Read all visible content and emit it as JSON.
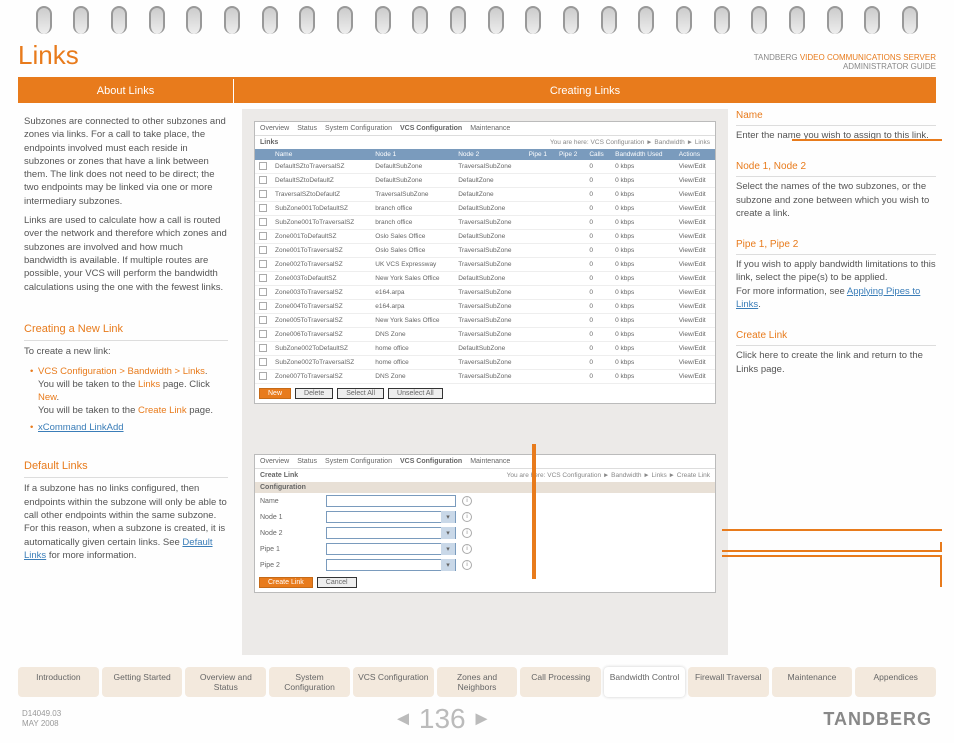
{
  "header": {
    "title": "Links",
    "brand_line": "TANDBERG",
    "brand_prod": "VIDEO COMMUNICATIONS SERVER",
    "brand_sub": "ADMINISTRATOR GUIDE"
  },
  "tabs": {
    "left": "About Links",
    "right": "Creating Links"
  },
  "about": {
    "p1": "Subzones are connected to other subzones and zones via links. For a call to take place, the endpoints involved must each reside in subzones or zones that have a link between them. The link does not need to be direct; the two endpoints may be linked via one or more intermediary subzones.",
    "p2": "Links are used to calculate how a call is routed over the network and therefore which zones and subzones are involved and how much bandwidth is available. If multiple routes are possible, your VCS will perform the bandwidth calculations using the one with the fewest links."
  },
  "create": {
    "title": "Creating a New Link",
    "intro": "To create a new link:",
    "b1a": "VCS Configuration > Bandwidth > Links",
    "b1b": ".",
    "b1c": "You will be taken to the ",
    "b1d": "Links",
    "b1e": " page. Click ",
    "b1f": "New",
    "b1g": ".",
    "b2a": "You will be taken to the ",
    "b2b": "Create Link",
    "b2c": " page.",
    "b3": "xCommand LinkAdd"
  },
  "default": {
    "title": "Default Links",
    "p": "If a subzone has no links configured, then endpoints within the subzone will only be able to call other endpoints within the same subzone. For this reason, when a subzone is created, it is automatically given certain links. See ",
    "link": "Default Links",
    "p2": " for more information."
  },
  "shot_nav": {
    "i1": "Overview",
    "i2": "Status",
    "i3": "System Configuration",
    "i4": "VCS Configuration",
    "i5": "Maintenance"
  },
  "shot1": {
    "title": "Links",
    "bc": "You are here: VCS Configuration ► Bandwidth ► Links",
    "cols": [
      "",
      "Name",
      "Node 1",
      "Node 2",
      "Pipe 1",
      "Pipe 2",
      "Calls",
      "Bandwidth Used",
      "Actions"
    ],
    "rows": [
      [
        "DefaultSZtoTraversalSZ",
        "DefaultSubZone",
        "TraversalSubZone",
        "",
        "",
        "0",
        "0 kbps",
        "View/Edit"
      ],
      [
        "DefaultSZtoDefaultZ",
        "DefaultSubZone",
        "DefaultZone",
        "",
        "",
        "0",
        "0 kbps",
        "View/Edit"
      ],
      [
        "TraversalSZtoDefaultZ",
        "TraversalSubZone",
        "DefaultZone",
        "",
        "",
        "0",
        "0 kbps",
        "View/Edit"
      ],
      [
        "SubZone001ToDefaultSZ",
        "branch office",
        "DefaultSubZone",
        "",
        "",
        "0",
        "0 kbps",
        "View/Edit"
      ],
      [
        "SubZone001ToTraversalSZ",
        "branch office",
        "TraversalSubZone",
        "",
        "",
        "0",
        "0 kbps",
        "View/Edit"
      ],
      [
        "Zone001ToDefaultSZ",
        "Oslo Sales Office",
        "DefaultSubZone",
        "",
        "",
        "0",
        "0 kbps",
        "View/Edit"
      ],
      [
        "Zone001ToTraversalSZ",
        "Oslo Sales Office",
        "TraversalSubZone",
        "",
        "",
        "0",
        "0 kbps",
        "View/Edit"
      ],
      [
        "Zone002ToTraversalSZ",
        "UK VCS Expressway",
        "TraversalSubZone",
        "",
        "",
        "0",
        "0 kbps",
        "View/Edit"
      ],
      [
        "Zone003ToDefaultSZ",
        "New York Sales Office",
        "DefaultSubZone",
        "",
        "",
        "0",
        "0 kbps",
        "View/Edit"
      ],
      [
        "Zone003ToTraversalSZ",
        "e164.arpa",
        "TraversalSubZone",
        "",
        "",
        "0",
        "0 kbps",
        "View/Edit"
      ],
      [
        "Zone004ToTraversalSZ",
        "e164.arpa",
        "TraversalSubZone",
        "",
        "",
        "0",
        "0 kbps",
        "View/Edit"
      ],
      [
        "Zone005ToTraversalSZ",
        "New York Sales Office",
        "TraversalSubZone",
        "",
        "",
        "0",
        "0 kbps",
        "View/Edit"
      ],
      [
        "Zone006ToTraversalSZ",
        "DNS Zone",
        "TraversalSubZone",
        "",
        "",
        "0",
        "0 kbps",
        "View/Edit"
      ],
      [
        "SubZone002ToDefaultSZ",
        "home office",
        "DefaultSubZone",
        "",
        "",
        "0",
        "0 kbps",
        "View/Edit"
      ],
      [
        "SubZone002ToTraversalSZ",
        "home office",
        "TraversalSubZone",
        "",
        "",
        "0",
        "0 kbps",
        "View/Edit"
      ],
      [
        "Zone007ToTraversalSZ",
        "DNS Zone",
        "TraversalSubZone",
        "",
        "",
        "0",
        "0 kbps",
        "View/Edit"
      ]
    ],
    "btn_new": "New",
    "btn_del": "Delete",
    "btn_sa": "Select All",
    "btn_ua": "Unselect All"
  },
  "shot2": {
    "title": "Create Link",
    "bc": "You are here: VCS Configuration ► Bandwidth ► Links ► Create Link",
    "conf": "Configuration",
    "rows": [
      "Name",
      "Node 1",
      "Node 2",
      "Pipe 1",
      "Pipe 2"
    ],
    "btn_create": "Create Link",
    "btn_cancel": "Cancel"
  },
  "right": {
    "name": {
      "t": "Name",
      "d": "Enter the name you wish to assign to this link."
    },
    "nodes": {
      "t": "Node 1, Node 2",
      "d": "Select the names of the two subzones, or the subzone and zone between which you wish to create a link."
    },
    "pipes": {
      "t": "Pipe 1, Pipe 2",
      "d1": "If you wish to apply bandwidth limitations to this link, select the pipe(s) to be applied.",
      "d2": "For more information, see ",
      "link": "Applying Pipes to Links",
      "d3": "."
    },
    "cl": {
      "t": "Create Link",
      "d": "Click here to create the link and return to the Links page."
    }
  },
  "nav": [
    "Introduction",
    "Getting Started",
    "Overview and Status",
    "System Configuration",
    "VCS Configuration",
    "Zones and Neighbors",
    "Call Processing",
    "Bandwidth Control",
    "Firewall Traversal",
    "Maintenance",
    "Appendices"
  ],
  "nav_active": 7,
  "footer": {
    "doc": "D14049.03",
    "date": "MAY 2008",
    "page": "136",
    "brand": "TANDBERG"
  }
}
